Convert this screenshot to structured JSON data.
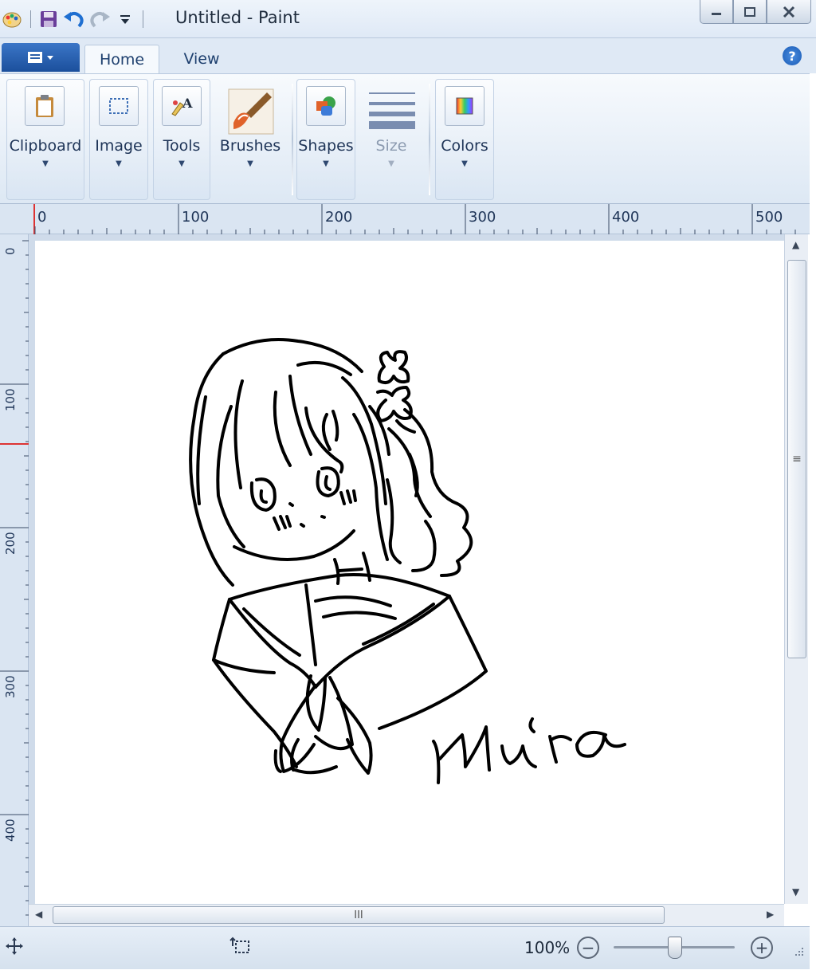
{
  "window": {
    "title": "Untitled - Paint"
  },
  "quick_access": {
    "icons": [
      "paint-app-icon",
      "save-icon",
      "undo-icon",
      "redo-icon",
      "customize-qat-icon"
    ]
  },
  "ribbon_tabs": {
    "app_menu_icon": "app-menu-icon",
    "home": "Home",
    "view": "View",
    "help": "?"
  },
  "ribbon_groups": {
    "clipboard": "Clipboard",
    "image": "Image",
    "tools": "Tools",
    "brushes": "Brushes",
    "shapes": "Shapes",
    "size": "Size",
    "colors": "Colors"
  },
  "rulers": {
    "horizontal": [
      "0",
      "100",
      "200",
      "300",
      "400",
      "500"
    ],
    "vertical": [
      "0",
      "100",
      "200",
      "300",
      "400"
    ]
  },
  "canvas": {
    "drawing": "line drawing of a girl in a sailor uniform with signature",
    "signature_text": "Mira"
  },
  "scrollbars": {
    "vertical_grip": "≡",
    "horizontal_grip": "III"
  },
  "status": {
    "zoom": "100%",
    "zoom_out": "−",
    "zoom_in": "+",
    "zoom_level": 0.5
  }
}
